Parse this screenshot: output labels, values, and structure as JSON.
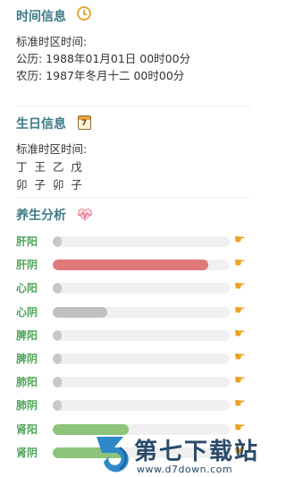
{
  "time_info": {
    "title": "时间信息",
    "std_label": "标准时区时间:",
    "gregorian": "公历: 1988年01月01日 00时00分",
    "lunar": "农历: 1987年冬月十二 00时00分"
  },
  "birth_info": {
    "title": "生日信息",
    "calendar_icon_num": "7",
    "std_label": "标准时区时间:",
    "stems": "丁 王 乙 戊",
    "branches": "卯 子 卯 子"
  },
  "health": {
    "title": "养生分析",
    "rows": [
      {
        "name": "肝阳",
        "level": 0.04,
        "color": "#c8c8c8"
      },
      {
        "name": "肝阴",
        "level": 0.88,
        "color": "#e07a7a"
      },
      {
        "name": "心阳",
        "level": 0.04,
        "color": "#c8c8c8"
      },
      {
        "name": "心阴",
        "level": 0.31,
        "color": "#c0c0c0"
      },
      {
        "name": "脾阳",
        "level": 0.04,
        "color": "#c8c8c8"
      },
      {
        "name": "脾阴",
        "level": 0.04,
        "color": "#c8c8c8"
      },
      {
        "name": "肺阳",
        "level": 0.04,
        "color": "#c8c8c8"
      },
      {
        "name": "肺阴",
        "level": 0.04,
        "color": "#c8c8c8"
      },
      {
        "name": "肾阳",
        "level": 0.43,
        "color": "#8cc47a"
      },
      {
        "name": "肾阴",
        "level": 0.4,
        "color": "#8cc47a"
      }
    ],
    "hand_icon": "pointing-hand-icon"
  },
  "watermark": {
    "text": "第七下载站",
    "url": "www.d7down.com"
  }
}
